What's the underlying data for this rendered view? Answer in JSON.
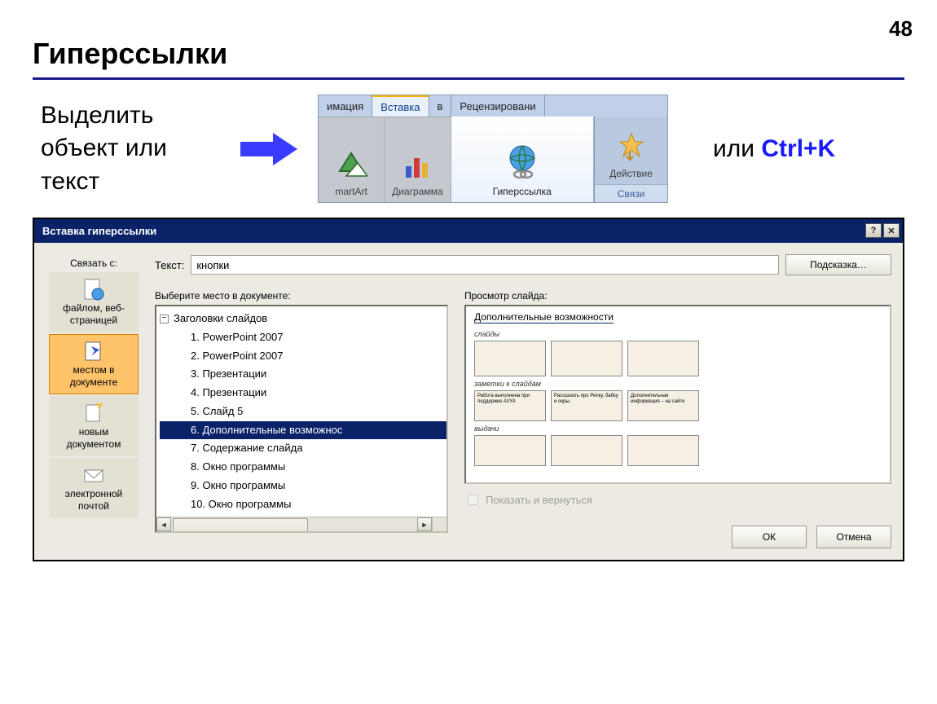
{
  "page_number": "48",
  "title": "Гиперссылки",
  "instruction": "Выделить объект или текст",
  "or_text": "или",
  "shortcut": "Ctrl+K",
  "ribbon": {
    "tabs": [
      "имация",
      "Вставка",
      "в",
      "Рецензировани"
    ],
    "active_tab_index": 1,
    "items": [
      {
        "label": "martArt"
      },
      {
        "label": "Диаграмма"
      },
      {
        "label": "Гиперссылка",
        "active": true
      },
      {
        "label": "Действие"
      }
    ],
    "group_label": "Связи"
  },
  "dialog": {
    "title": "Вставка гиперссылки",
    "link_with_label": "Связать с:",
    "sidebar": [
      {
        "label": "файлом, веб-страницей"
      },
      {
        "label": "местом в документе",
        "active": true
      },
      {
        "label": "новым документом"
      },
      {
        "label": "электронной почтой"
      }
    ],
    "text_label": "Текст:",
    "text_value": "кнопки",
    "hint_button": "Подсказка…",
    "choose_label": "Выберите место в документе:",
    "tree_root": "Заголовки слайдов",
    "tree_items": [
      "1. PowerPoint 2007",
      "2. PowerPoint 2007",
      "3. Презентации",
      "4. Презентации",
      "5. Слайд 5",
      "6. Дополнительные возможнос",
      "7. Содержание слайда",
      "8. Окно программы",
      "9. Окно программы",
      "10. Окно программы"
    ],
    "selected_tree_index": 5,
    "preview_label": "Просмотр слайда:",
    "preview_title": "Дополнительные возможности",
    "preview_sections": [
      "слайды",
      "заметки к слайдам",
      "выдачи"
    ],
    "preview_notes": [
      "Работа выполнена при поддержке АУУА",
      "Рассказать про Репку, бабку и окры.",
      "Дополнительная информация – на сайте"
    ],
    "show_return": "Показать и вернуться",
    "ok": "ОК",
    "cancel": "Отмена"
  }
}
